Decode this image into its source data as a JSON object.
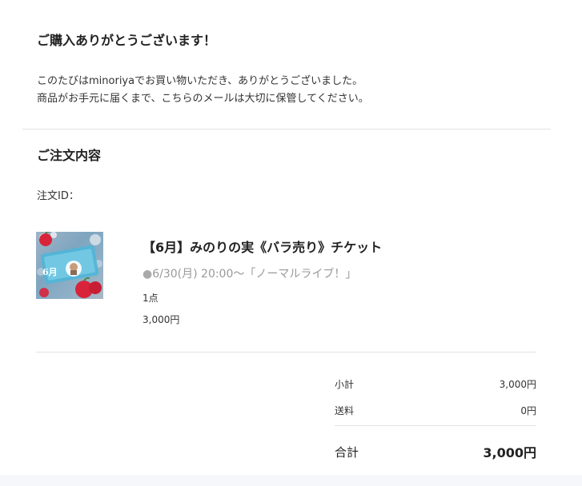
{
  "thanks_title": "ご購入ありがとうございます！",
  "message": {
    "line1": "このたびはminoriyaでお買い物いただき、ありがとうございました。",
    "line2": "商品がお手元に届くまで、こちらのメールは大切に保管してください。"
  },
  "order": {
    "section_title": "ご注文内容",
    "order_id_label": "注文ID："
  },
  "item": {
    "name": "【6月】みのりの実《バラ売り》チケット",
    "variant": "6/30(月) 20:00〜「ノーマルライブ！」",
    "variant_bullet": "●",
    "quantity": "1点",
    "price": "3,000円",
    "thumbnail_text": "6月"
  },
  "summary": {
    "subtotal_label": "小計",
    "subtotal_value": "3,000円",
    "shipping_label": "送料",
    "shipping_value": "0円",
    "total_label": "合計",
    "total_value": "3,000円"
  },
  "colors": {
    "text": "#222222",
    "muted": "#999999",
    "divider": "#e2e2e2",
    "apple_red": "#d8243b",
    "ticket_blue": "#4fb6d8"
  }
}
